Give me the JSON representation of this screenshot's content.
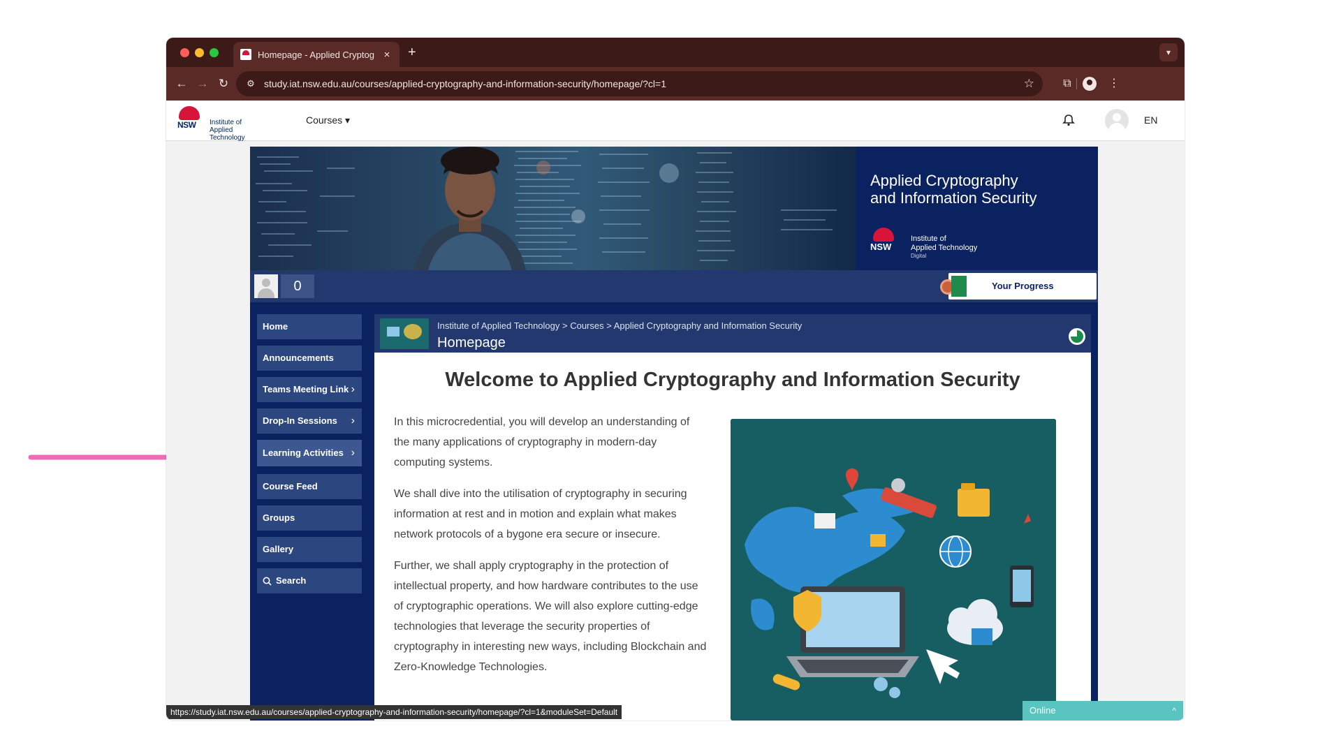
{
  "browser": {
    "tab_title": "Homepage - Applied Cryptog",
    "tab_close": "×",
    "new_tab": "+",
    "url": "study.iat.nsw.edu.au/courses/applied-cryptography-and-information-security/homepage/?cl=1",
    "status_url": "https://study.iat.nsw.edu.au/courses/applied-cryptography-and-information-security/homepage/?cl=1&moduleSet=Default"
  },
  "header": {
    "logo_nsw": "NSW",
    "logo_line1": "Institute of",
    "logo_line2": "Applied Technology",
    "courses_label": "Courses ▾",
    "lang": "EN"
  },
  "banner": {
    "title_line1": "Applied Cryptography",
    "title_line2": "and Information Security",
    "logo_nsw": "NSW",
    "logo_line1": "Institute of",
    "logo_line2": "Applied Technology",
    "logo_sub": "Digital"
  },
  "progress": {
    "points": "0",
    "label": "Your Progress"
  },
  "sidebar": {
    "items": [
      {
        "label": "Home"
      },
      {
        "label": "Announcements"
      },
      {
        "label": "Teams Meeting Link"
      },
      {
        "label": "Drop-In Sessions"
      },
      {
        "label": "Learning Activities"
      },
      {
        "label": "Course Feed"
      },
      {
        "label": "Groups"
      },
      {
        "label": "Gallery"
      },
      {
        "label": "Search"
      }
    ]
  },
  "breadcrumb": {
    "path": "Institute of Applied Technology  >  Courses  >  Applied Cryptography and Information Security",
    "title": "Homepage"
  },
  "content": {
    "heading": "Welcome to Applied Cryptography and Information Security",
    "p1": "In this microcredential, you will develop an understanding of the many applications of cryptography in modern-day computing systems.",
    "p2": "We shall dive into the utilisation of cryptography in securing information at rest and in motion and explain what makes network protocols of a bygone era secure or insecure.",
    "p3": "Further, we shall apply cryptography in the protection of intellectual property, and how hardware contributes to the use of cryptographic operations. We will also explore cutting-edge technologies that leverage the security properties of cryptography in interesting new ways, including Blockchain and Zero-Knowledge Technologies."
  },
  "chat": {
    "status": "Online",
    "caret": "^"
  },
  "colors": {
    "brand_navy": "#0b2260",
    "nav_item": "#2c4680",
    "accent_red": "#d7153a",
    "annotation_pink": "#f06bb4"
  }
}
